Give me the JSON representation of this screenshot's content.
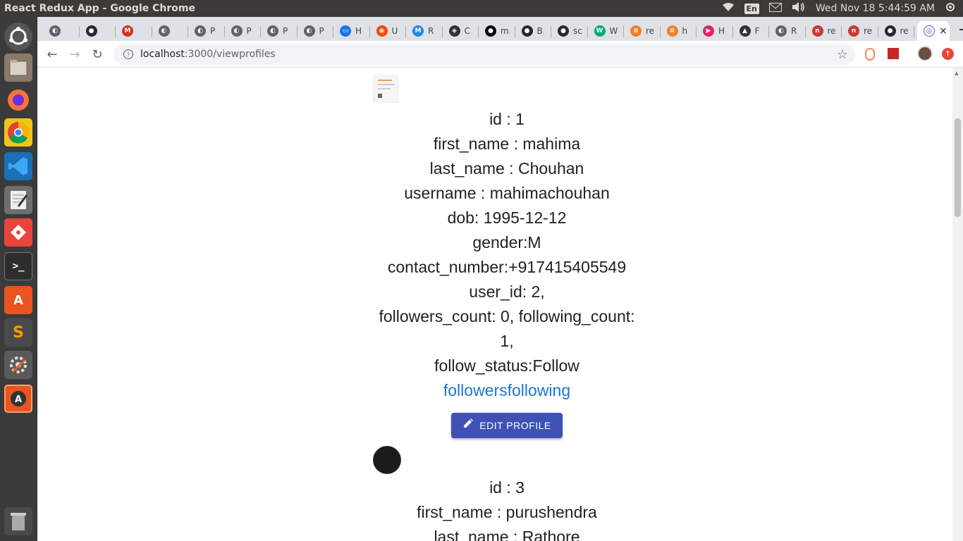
{
  "system_bar": {
    "window_title": "React Redux App - Google Chrome",
    "keyboard_layout": "En",
    "clock": "Wed Nov 18  5:44:59 AM"
  },
  "launcher": {
    "items": [
      "ubuntu-logo-icon",
      "files-icon",
      "firefox-icon",
      "chrome-icon",
      "vscode-icon",
      "text-editor-icon",
      "git-icon",
      "terminal-icon",
      "software-center-icon",
      "sublime-icon",
      "settings-icon",
      "updater-icon",
      "trash-icon"
    ]
  },
  "tabs": [
    {
      "label": "",
      "icon": "globe-icon",
      "color": "#5f6368"
    },
    {
      "label": "",
      "icon": "github-icon",
      "color": "#24292e"
    },
    {
      "label": "",
      "icon": "gmail-icon",
      "color": "#d93025"
    },
    {
      "label": "",
      "icon": "globe-icon",
      "color": "#5f6368"
    },
    {
      "label": "P",
      "icon": "globe-icon",
      "color": "#5f6368"
    },
    {
      "label": "P",
      "icon": "globe-icon",
      "color": "#5f6368"
    },
    {
      "label": "P",
      "icon": "globe-icon",
      "color": "#5f6368"
    },
    {
      "label": "P",
      "icon": "globe-icon",
      "color": "#5f6368"
    },
    {
      "label": "H",
      "icon": "monitor-icon",
      "color": "#1a73e8"
    },
    {
      "label": "U",
      "icon": "reddit-icon",
      "color": "#ff4500"
    },
    {
      "label": "R",
      "icon": "mui-icon",
      "color": "#1e88e5"
    },
    {
      "label": "C",
      "icon": "codesandbox-icon",
      "color": "#333"
    },
    {
      "label": "m",
      "icon": "medium-icon",
      "color": "#000"
    },
    {
      "label": "B",
      "icon": "github-icon",
      "color": "#24292e"
    },
    {
      "label": "sc",
      "icon": "github-icon",
      "color": "#24292e"
    },
    {
      "label": "W",
      "icon": "w3-icon",
      "color": "#04aa6d"
    },
    {
      "label": "re",
      "icon": "stackoverflow-icon",
      "color": "#f48024"
    },
    {
      "label": "h",
      "icon": "stackoverflow-icon",
      "color": "#f48024"
    },
    {
      "label": "H",
      "icon": "play-icon",
      "color": "#e91e63"
    },
    {
      "label": "F",
      "icon": "linux-icon",
      "color": "#333"
    },
    {
      "label": "R",
      "icon": "globe-icon",
      "color": "#5f6368"
    },
    {
      "label": "re",
      "icon": "npm-icon",
      "color": "#cb3837"
    },
    {
      "label": "re",
      "icon": "npm-icon",
      "color": "#cb3837"
    },
    {
      "label": "re",
      "icon": "github-icon",
      "color": "#24292e"
    }
  ],
  "active_tab": {
    "icon": "redux-icon",
    "close": "×"
  },
  "new_tab": "+",
  "toolbar": {
    "back": "←",
    "forward": "→",
    "reload": "↻",
    "url_host": "localhost",
    "url_path": ":3000/viewprofiles",
    "star": "☆"
  },
  "profiles": [
    {
      "id_line": "id : 1",
      "first_name_line": "first_name : mahima",
      "last_name_line": "last_name : Chouhan",
      "username_line": "username : mahimachouhan",
      "dob_line": "dob: 1995-12-12",
      "gender_line": "gender:M",
      "contact_line": "contact_number:+917415405549",
      "user_id_line": "user_id: 2,",
      "counts_line": "followers_count: 0, following_count: 1,",
      "follow_status_line": "follow_status:Follow",
      "links_line": "followersfollowing",
      "edit_label": "EDIT PROFILE"
    },
    {
      "id_line": "id : 3",
      "first_name_line": "first_name : purushendra",
      "last_name_line": "last_name : Rathore"
    }
  ]
}
